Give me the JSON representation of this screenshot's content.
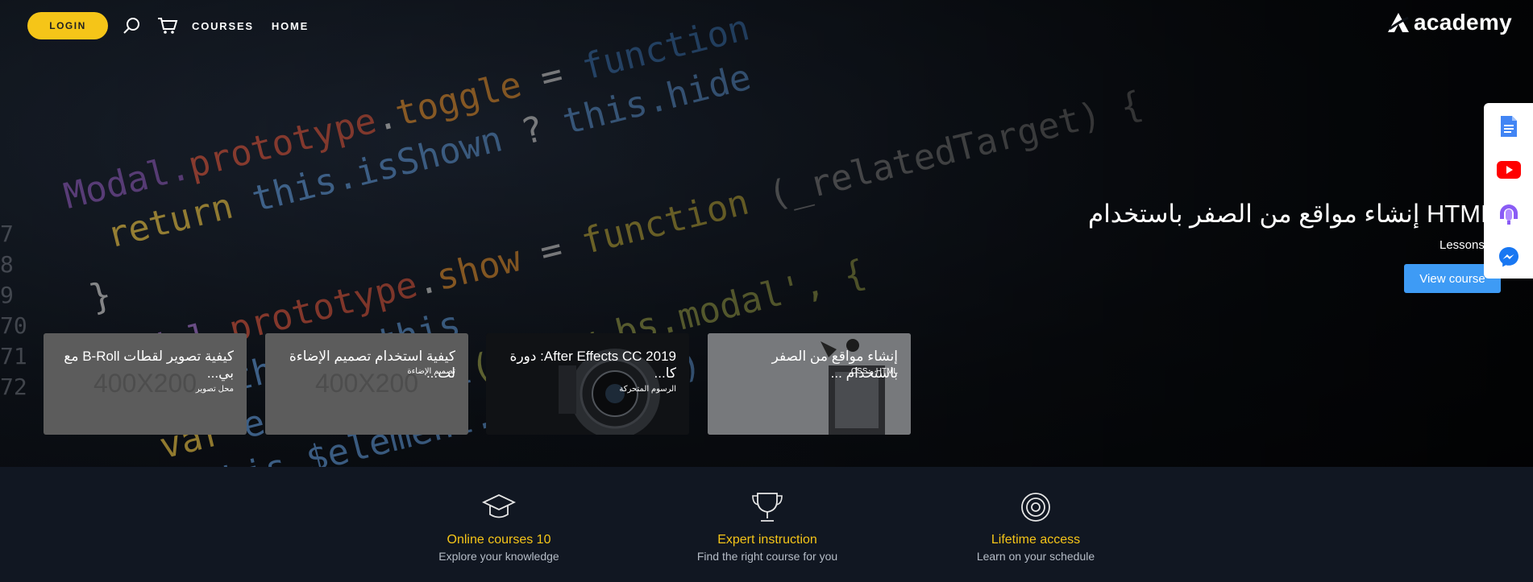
{
  "nav": {
    "login_label": "LOGIN",
    "search_icon": "search-icon",
    "cart_icon": "cart-icon",
    "courses_label": "COURSES",
    "home_label": "HOME"
  },
  "logo": {
    "text": "academy"
  },
  "featured": {
    "title": "إنشاء مواقع من الصفر باستخدام HTML & CSS",
    "lessons": "Lessons",
    "view_label": "View course"
  },
  "side": [
    "document-icon",
    "youtube-icon",
    "podcast-icon",
    "messenger-icon"
  ],
  "cards": [
    {
      "title": "كيفية تصوير لقطات B-Roll مع بي...",
      "placeholder": "400X200",
      "subtitle": "محل تصوير"
    },
    {
      "title": "كيفية استخدام تصميم الإضاءة لت...",
      "placeholder": "400X200",
      "subtitle": "تصميم الإضاءة"
    },
    {
      "title": "After Effects CC 2019: دورة كا...",
      "subtitle": "الرسوم المتحركة"
    },
    {
      "title": "إنشاء مواقع من الصفر باستخدام ...",
      "subtitle": "HTML و CSS"
    }
  ],
  "features": [
    {
      "title": "Online courses 10",
      "subtitle": "Explore your knowledge"
    },
    {
      "title": "Expert instruction",
      "subtitle": "Find the right course for you"
    },
    {
      "title": "Lifetime access",
      "subtitle": "Learn on your schedule"
    }
  ],
  "colors": {
    "accent": "#f5c518",
    "button_blue": "#3e9bf5",
    "strip_bg": "#111722"
  }
}
